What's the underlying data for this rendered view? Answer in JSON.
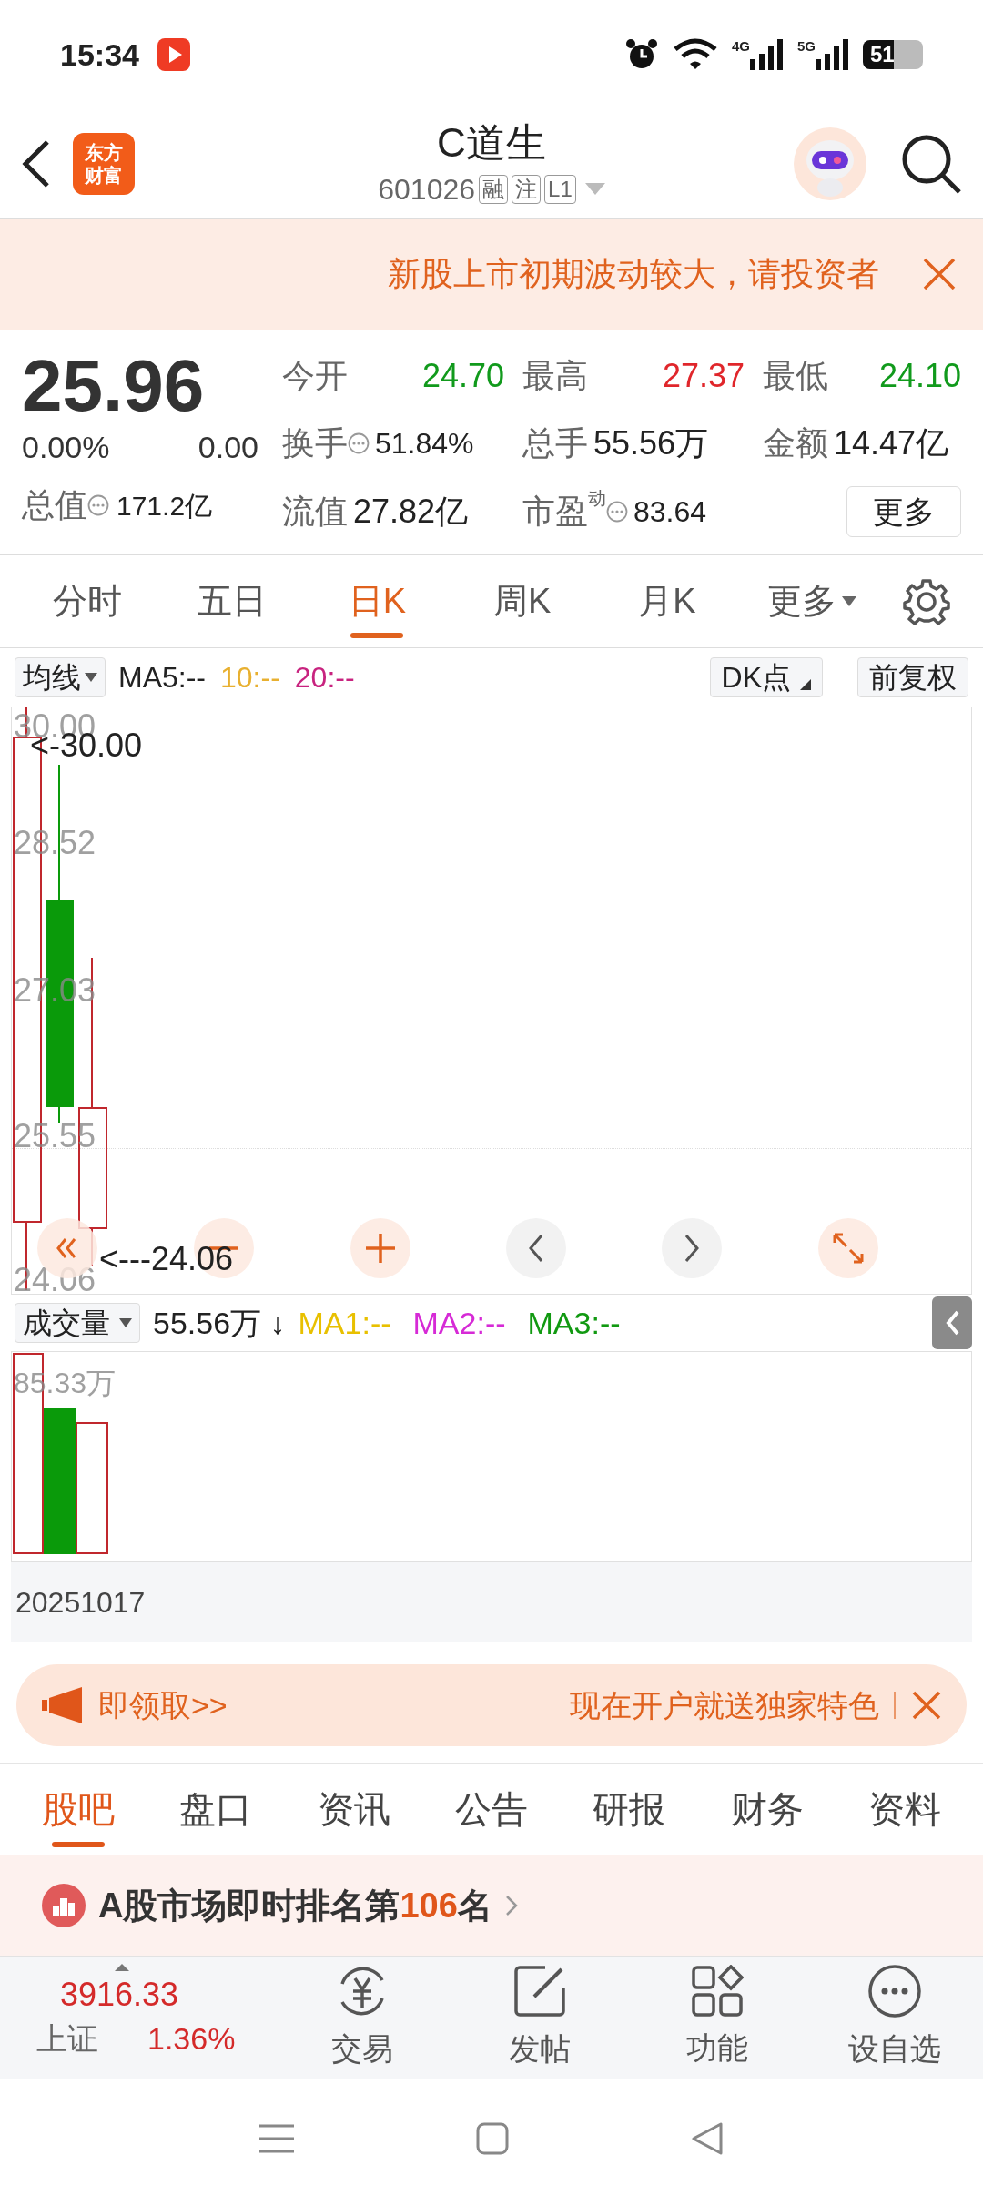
{
  "status_bar": {
    "time": "15:34",
    "networks": [
      "4G",
      "5G"
    ],
    "battery": "51"
  },
  "header": {
    "logo": [
      "东方",
      "财富"
    ],
    "title": "C道生",
    "code": "601026",
    "tags": [
      "融",
      "注",
      "L1"
    ]
  },
  "notice": {
    "text": "新股上市初期波动较大，请投资者"
  },
  "quote": {
    "price": "25.96",
    "change_pct": "0.00%",
    "change": "0.00",
    "total_value": {
      "label": "总值",
      "value": "171.2亿"
    },
    "stats": [
      {
        "label": "今开",
        "value": "24.70",
        "color": "#119a1c"
      },
      {
        "label": "最高",
        "value": "27.37",
        "color": "#e0262b"
      },
      {
        "label": "最低",
        "value": "24.10",
        "color": "#119a1c"
      },
      {
        "label": "换手",
        "value": "51.84%",
        "info": true
      },
      {
        "label": "总手",
        "value": "55.56万"
      },
      {
        "label": "金额",
        "value": "14.47亿"
      },
      {
        "label": "流值",
        "value": "27.82亿"
      },
      {
        "label": "市盈",
        "sup": "动",
        "value": "83.64",
        "info": true
      }
    ],
    "more_button": "更多"
  },
  "period_tabs": [
    {
      "label": "分时",
      "selected": false
    },
    {
      "label": "五日",
      "selected": false
    },
    {
      "label": "日K",
      "selected": true
    },
    {
      "label": "周K",
      "selected": false
    },
    {
      "label": "月K",
      "selected": false
    },
    {
      "label": "更多",
      "selected": false,
      "kind": "dropdown"
    }
  ],
  "chart_toolbar": {
    "selector": "均线",
    "ma": [
      {
        "label": "MA5:--",
        "color": "#222222"
      },
      {
        "label": "10:--",
        "color": "#e8b030"
      },
      {
        "label": "20:--",
        "color": "#c8237f"
      }
    ],
    "buttons": [
      "DK点",
      "前复权"
    ]
  },
  "kchart": {
    "y_labels": [
      "30.00",
      "28.52",
      "27.03",
      "25.55",
      "24.06"
    ],
    "high_marker": "<-30.00",
    "low_marker": "<---24.06"
  },
  "volume": {
    "selector": "成交量",
    "value": "55.56万 ↓",
    "ma": [
      {
        "label": "MA1:--",
        "color": "#e8c000"
      },
      {
        "label": "MA2:--",
        "color": "#d62ad6"
      },
      {
        "label": "MA3:--",
        "color": "#119911"
      }
    ],
    "y_label": "85.33万",
    "date": "20251017"
  },
  "ad": {
    "left": "即领取>>",
    "right": "现在开户就送独家特色"
  },
  "section_tabs": [
    {
      "label": "股吧",
      "selected": true
    },
    {
      "label": "盘口",
      "selected": false
    },
    {
      "label": "资讯",
      "selected": false
    },
    {
      "label": "公告",
      "selected": false
    },
    {
      "label": "研报",
      "selected": false
    },
    {
      "label": "财务",
      "selected": false
    },
    {
      "label": "资料",
      "selected": false
    }
  ],
  "ranking": {
    "text": "A股市场即时排名第**106**名"
  },
  "bottom_nav": {
    "index": {
      "value": "3916.33",
      "name": "上证",
      "change": "1.36%"
    },
    "items": [
      "交易",
      "发帖",
      "功能",
      "设自选"
    ]
  }
}
